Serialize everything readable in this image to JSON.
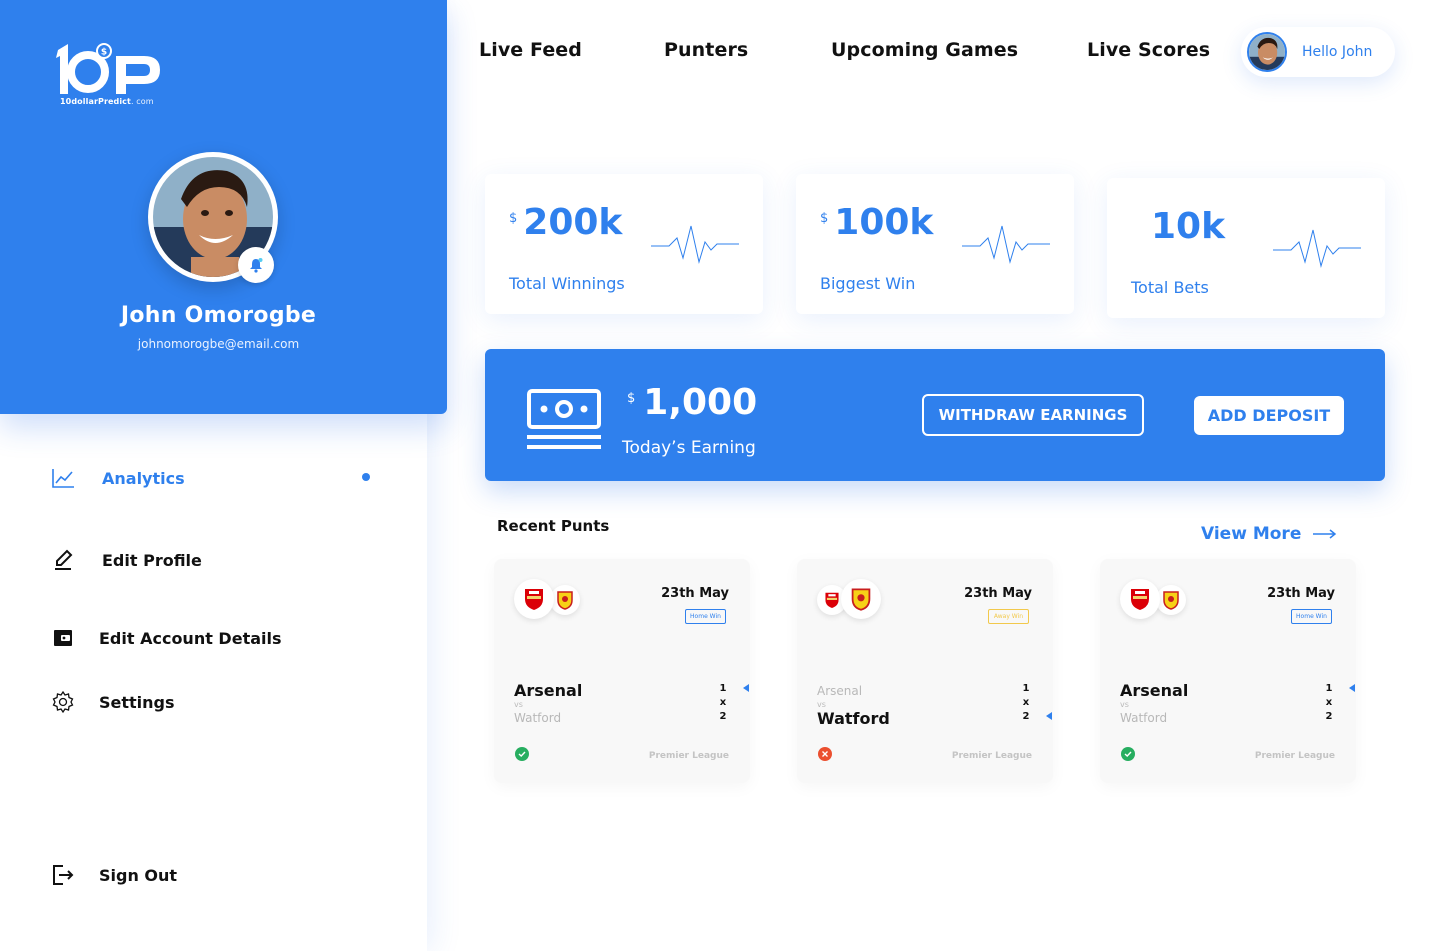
{
  "brand": {
    "logo_text": "10dollarPredict",
    "logo_suffix": ". com"
  },
  "profile": {
    "name": "John Omorogbe",
    "email": "johnomorogbe@email.com"
  },
  "sidebar": {
    "items": [
      {
        "label": "Analytics",
        "icon": "analytics-icon",
        "active": true
      },
      {
        "label": "Edit Profile",
        "icon": "pencil-icon"
      },
      {
        "label": "Edit Account Details",
        "icon": "wallet-icon"
      },
      {
        "label": "Settings",
        "icon": "gear-icon"
      }
    ],
    "sign_out": "Sign Out"
  },
  "topnav": {
    "links": [
      "Live Feed",
      "Punters",
      "Upcoming Games",
      "Live Scores"
    ],
    "greeting": "Hello John"
  },
  "stats": [
    {
      "currency": "$",
      "value": "200k",
      "label": "Total Winnings"
    },
    {
      "currency": "$",
      "value": "100k",
      "label": "Biggest Win"
    },
    {
      "currency": "",
      "value": "10k",
      "label": "Total Bets"
    }
  ],
  "earnings": {
    "currency": "$",
    "value": "1,000",
    "label": "Today’s Earning",
    "withdraw_label": "WITHDRAW EARNINGS",
    "deposit_label": "ADD DEPOSIT"
  },
  "recent": {
    "title": "Recent Punts",
    "view_more": "View More",
    "punts": [
      {
        "date": "23th May",
        "tag": "Home Win",
        "home": "Arsenal",
        "vs": "vs",
        "away": "Watford",
        "odds": [
          "1",
          "x",
          "2"
        ],
        "league": "Premier League",
        "result": "win",
        "highlight": "home"
      },
      {
        "date": "23th May",
        "tag": "Away Win",
        "home": "Arsenal",
        "vs": "vs",
        "away": "Watford",
        "odds": [
          "1",
          "x",
          "2"
        ],
        "league": "Premier League",
        "result": "loss",
        "highlight": "away"
      },
      {
        "date": "23th May",
        "tag": "Home Win",
        "home": "Arsenal",
        "vs": "vs",
        "away": "Watford",
        "odds": [
          "1",
          "x",
          "2"
        ],
        "league": "Premier League",
        "result": "win",
        "highlight": "home"
      }
    ]
  },
  "colors": {
    "primary": "#2f80ed",
    "win": "#27ae60",
    "loss": "#eb4f2f",
    "away_tag": "#f2c94c"
  }
}
